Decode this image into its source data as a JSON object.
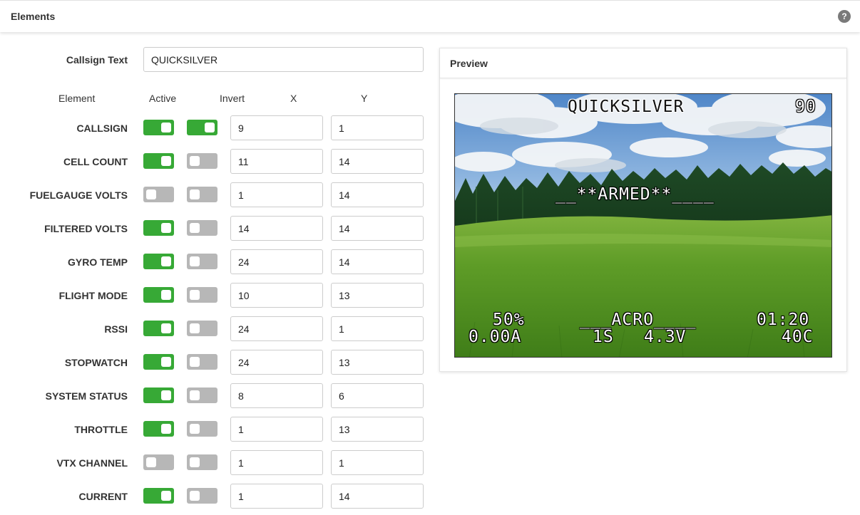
{
  "header": {
    "title": "Elements",
    "help_icon": "question-circle-icon"
  },
  "callsign": {
    "label": "Callsign Text",
    "value": "QUICKSILVER"
  },
  "columns": {
    "element": "Element",
    "active": "Active",
    "invert": "Invert",
    "x": "X",
    "y": "Y"
  },
  "colors": {
    "toggle_on": "#37a936",
    "toggle_off": "#b7b7b7"
  },
  "rows": [
    {
      "name": "CALLSIGN",
      "active": true,
      "invert": true,
      "x": "9",
      "y": "1"
    },
    {
      "name": "CELL COUNT",
      "active": true,
      "invert": false,
      "x": "11",
      "y": "14"
    },
    {
      "name": "FUELGAUGE VOLTS",
      "active": false,
      "invert": false,
      "x": "1",
      "y": "14"
    },
    {
      "name": "FILTERED VOLTS",
      "active": true,
      "invert": false,
      "x": "14",
      "y": "14"
    },
    {
      "name": "GYRO TEMP",
      "active": true,
      "invert": false,
      "x": "24",
      "y": "14"
    },
    {
      "name": "FLIGHT MODE",
      "active": true,
      "invert": false,
      "x": "10",
      "y": "13"
    },
    {
      "name": "RSSI",
      "active": true,
      "invert": false,
      "x": "24",
      "y": "1"
    },
    {
      "name": "STOPWATCH",
      "active": true,
      "invert": false,
      "x": "24",
      "y": "13"
    },
    {
      "name": "SYSTEM STATUS",
      "active": true,
      "invert": false,
      "x": "8",
      "y": "6"
    },
    {
      "name": "THROTTLE",
      "active": true,
      "invert": false,
      "x": "1",
      "y": "13"
    },
    {
      "name": "VTX CHANNEL",
      "active": false,
      "invert": false,
      "x": "1",
      "y": "1"
    },
    {
      "name": "CURRENT",
      "active": true,
      "invert": false,
      "x": "1",
      "y": "14"
    }
  ],
  "preview": {
    "title": "Preview",
    "osd": {
      "callsign": "QUICKSILVER",
      "rssi": "90",
      "status": "__**ARMED**____",
      "throttle": "50%",
      "flight_mode": "___ACRO____",
      "stopwatch": "01:20",
      "current": "0.00A",
      "cell_count": "1S",
      "filtered_volts": "4.3V",
      "gyro_temp": "40C"
    }
  }
}
